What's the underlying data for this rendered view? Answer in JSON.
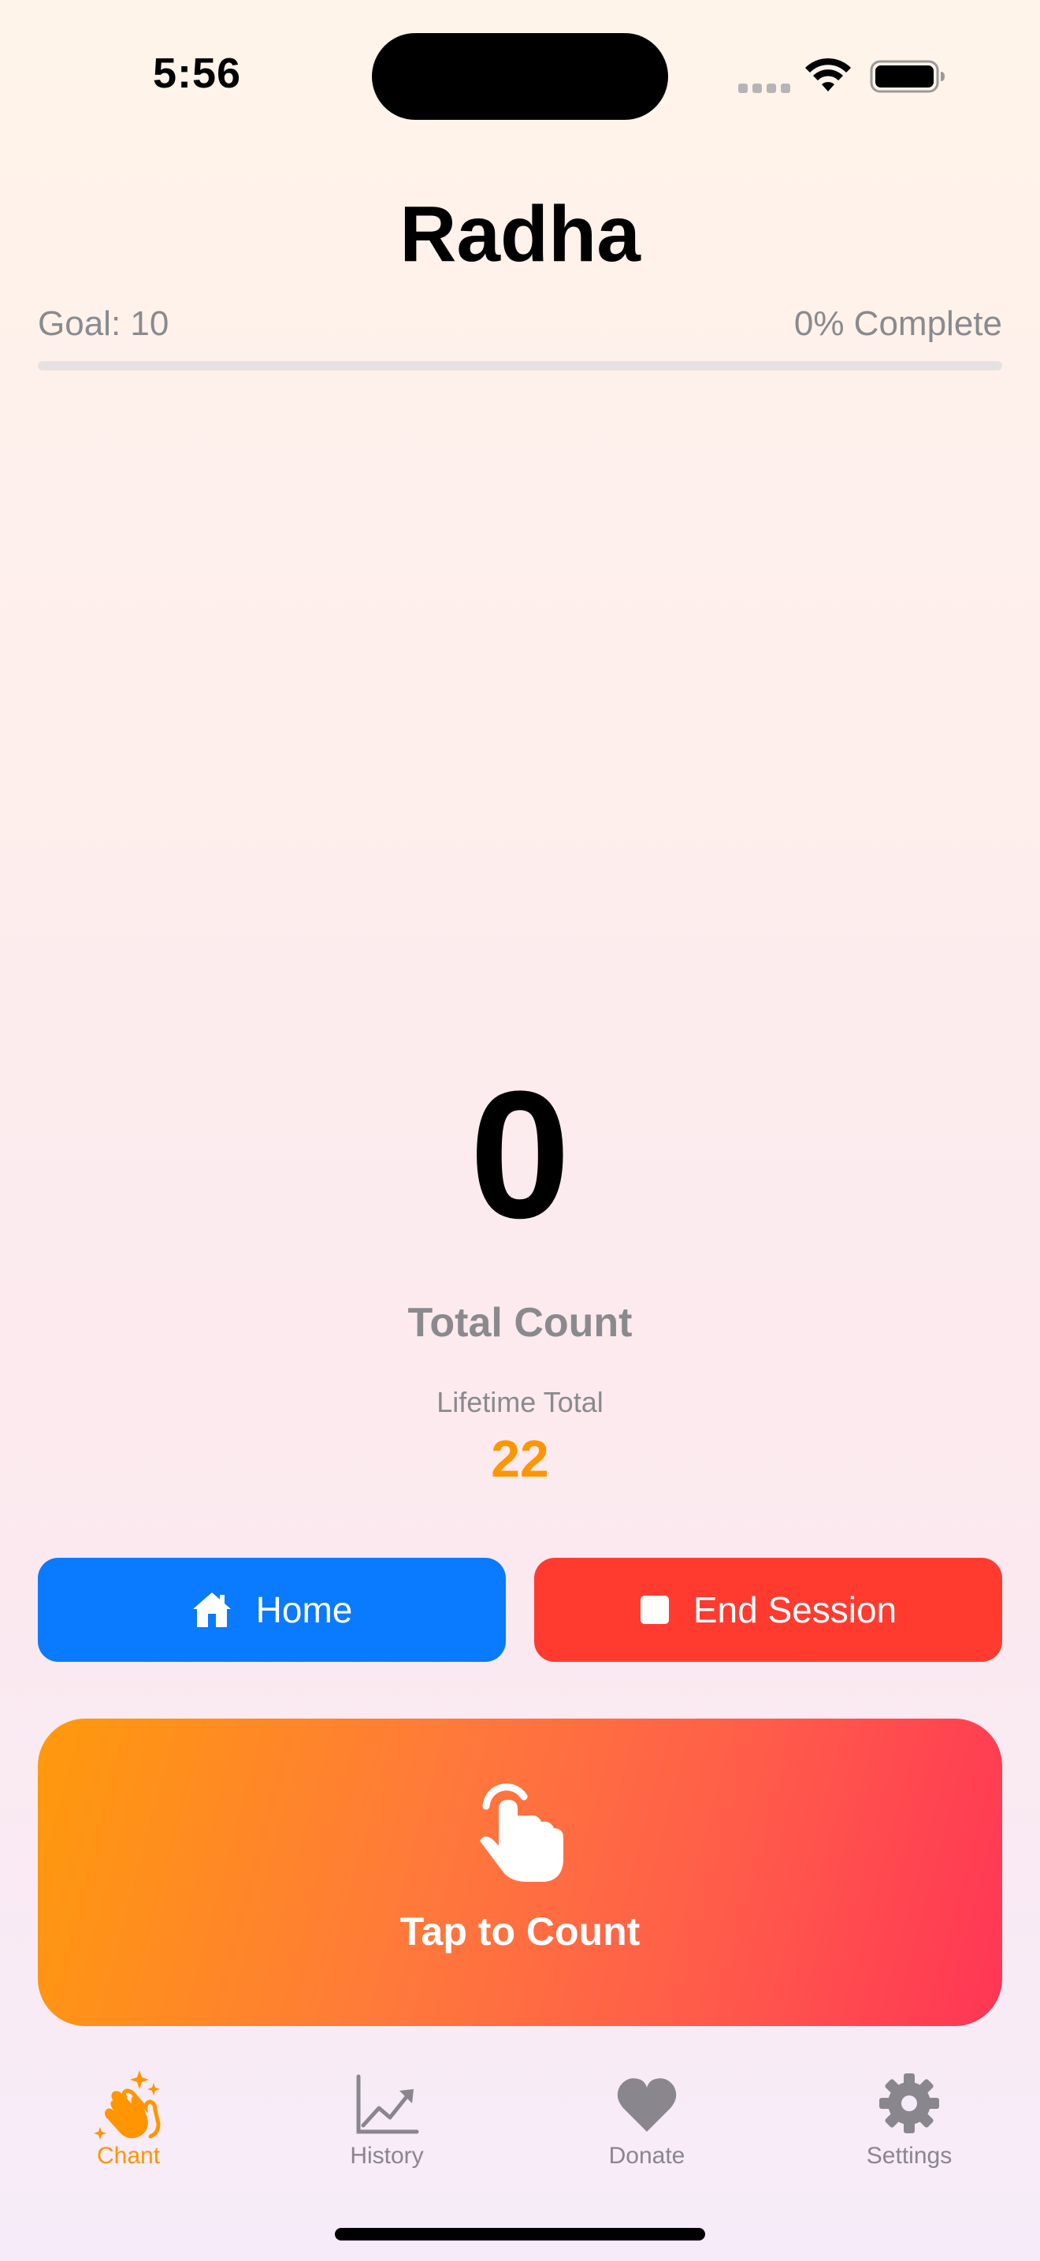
{
  "status_bar": {
    "time": "5:56"
  },
  "header": {
    "title": "Radha",
    "goal_label": "Goal: 10",
    "progress_label": "0% Complete",
    "progress_fraction": 0
  },
  "counter": {
    "value": "0",
    "label": "Total Count",
    "lifetime_label": "Lifetime Total",
    "lifetime_value": "22"
  },
  "actions": {
    "home_label": "Home",
    "end_session_label": "End Session",
    "tap_label": "Tap to Count"
  },
  "tabs": [
    {
      "label": "Chant",
      "icon": "clapping-hands-icon",
      "active": true
    },
    {
      "label": "History",
      "icon": "chart-line-icon",
      "active": false
    },
    {
      "label": "Donate",
      "icon": "heart-icon",
      "active": false
    },
    {
      "label": "Settings",
      "icon": "gear-icon",
      "active": false
    }
  ],
  "colors": {
    "accent": "#ff9500",
    "home_button": "#0a7aff",
    "end_button": "#ff3b30",
    "tab_inactive": "#8a868e"
  }
}
